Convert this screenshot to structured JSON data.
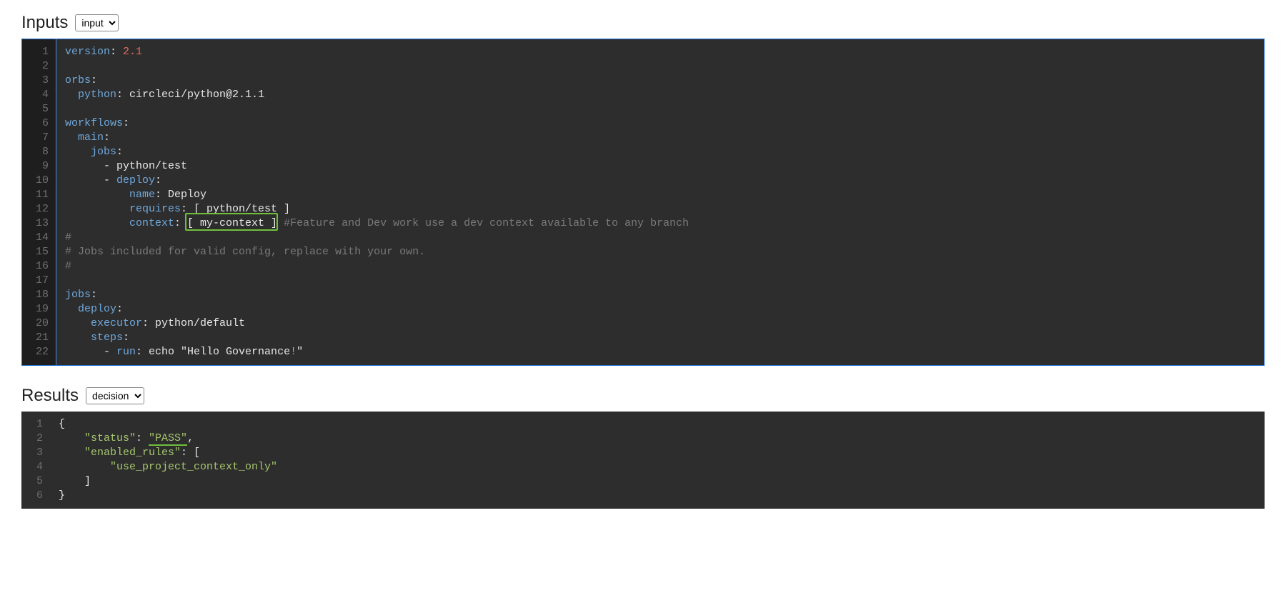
{
  "inputs": {
    "title": "Inputs",
    "selector": "input",
    "code": {
      "lines": [
        {
          "n": 1,
          "seg": [
            [
              "k",
              "version"
            ],
            [
              "s",
              ": "
            ],
            [
              "n",
              "2.1"
            ]
          ]
        },
        {
          "n": 2,
          "seg": [
            [
              "s",
              ""
            ]
          ]
        },
        {
          "n": 3,
          "seg": [
            [
              "k",
              "orbs"
            ],
            [
              "s",
              ":"
            ]
          ]
        },
        {
          "n": 4,
          "seg": [
            [
              "s",
              "  "
            ],
            [
              "k",
              "python"
            ],
            [
              "s",
              ": circleci/python@2.1.1"
            ]
          ]
        },
        {
          "n": 5,
          "seg": [
            [
              "s",
              ""
            ]
          ]
        },
        {
          "n": 6,
          "seg": [
            [
              "k",
              "workflows"
            ],
            [
              "s",
              ":"
            ]
          ]
        },
        {
          "n": 7,
          "seg": [
            [
              "s",
              "  "
            ],
            [
              "k",
              "main"
            ],
            [
              "s",
              ":"
            ]
          ]
        },
        {
          "n": 8,
          "seg": [
            [
              "s",
              "    "
            ],
            [
              "k",
              "jobs"
            ],
            [
              "s",
              ":"
            ]
          ]
        },
        {
          "n": 9,
          "seg": [
            [
              "s",
              "      - python/test"
            ]
          ]
        },
        {
          "n": 10,
          "seg": [
            [
              "s",
              "      - "
            ],
            [
              "k",
              "deploy"
            ],
            [
              "s",
              ":"
            ]
          ]
        },
        {
          "n": 11,
          "seg": [
            [
              "s",
              "          "
            ],
            [
              "k",
              "name"
            ],
            [
              "s",
              ": Deploy"
            ]
          ]
        },
        {
          "n": 12,
          "seg": [
            [
              "s",
              "          "
            ],
            [
              "k",
              "requires"
            ],
            [
              "s",
              ": [ python/test ]"
            ]
          ]
        },
        {
          "n": 13,
          "seg": [
            [
              "s",
              "          "
            ],
            [
              "k",
              "context"
            ],
            [
              "s",
              ": [ my-context ] "
            ],
            [
              "c",
              "#Feature and Dev work use a dev context available to any branch"
            ]
          ]
        },
        {
          "n": 14,
          "seg": [
            [
              "c",
              "#"
            ]
          ]
        },
        {
          "n": 15,
          "seg": [
            [
              "c",
              "# Jobs included for valid config, replace with your own."
            ]
          ]
        },
        {
          "n": 16,
          "seg": [
            [
              "c",
              "#"
            ]
          ]
        },
        {
          "n": 17,
          "seg": [
            [
              "s",
              ""
            ]
          ]
        },
        {
          "n": 18,
          "seg": [
            [
              "k",
              "jobs"
            ],
            [
              "s",
              ":"
            ]
          ]
        },
        {
          "n": 19,
          "seg": [
            [
              "s",
              "  "
            ],
            [
              "k",
              "deploy"
            ],
            [
              "s",
              ":"
            ]
          ]
        },
        {
          "n": 20,
          "seg": [
            [
              "s",
              "    "
            ],
            [
              "k",
              "executor"
            ],
            [
              "s",
              ": python/default"
            ]
          ]
        },
        {
          "n": 21,
          "seg": [
            [
              "s",
              "    "
            ],
            [
              "k",
              "steps"
            ],
            [
              "s",
              ":"
            ]
          ]
        },
        {
          "n": 22,
          "seg": [
            [
              "s",
              "      - "
            ],
            [
              "k",
              "run"
            ],
            [
              "s",
              ": echo \"Hello Governance"
            ],
            [
              "p",
              "!"
            ],
            [
              "s",
              "\""
            ]
          ]
        }
      ],
      "highlight": {
        "line": 13,
        "text": " my-context "
      }
    }
  },
  "results": {
    "title": "Results",
    "selector": "decision",
    "code": {
      "lines": [
        {
          "n": 1,
          "seg": [
            [
              "s",
              "{"
            ]
          ]
        },
        {
          "n": 2,
          "seg": [
            [
              "s",
              "    "
            ],
            [
              "g",
              "\"status\""
            ],
            [
              "s",
              ": "
            ],
            [
              "gU",
              "\"PASS\""
            ],
            [
              "s",
              ","
            ]
          ]
        },
        {
          "n": 3,
          "seg": [
            [
              "s",
              "    "
            ],
            [
              "g",
              "\"enabled_rules\""
            ],
            [
              "s",
              ": ["
            ]
          ]
        },
        {
          "n": 4,
          "seg": [
            [
              "s",
              "        "
            ],
            [
              "g",
              "\"use_project_context_only\""
            ]
          ]
        },
        {
          "n": 5,
          "seg": [
            [
              "s",
              "    ]"
            ]
          ]
        },
        {
          "n": 6,
          "seg": [
            [
              "s",
              "}"
            ]
          ]
        }
      ]
    }
  }
}
